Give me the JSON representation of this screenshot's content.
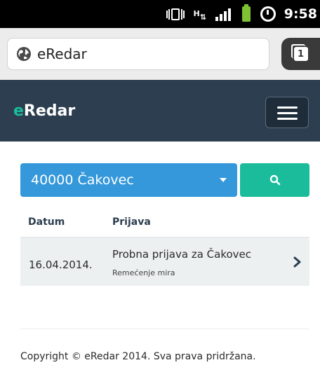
{
  "status_bar": {
    "time": "9:58",
    "network_type": "H",
    "icons": [
      "vibrate-icon",
      "hspa-data-icon",
      "signal-icon",
      "battery-icon",
      "alarm-icon"
    ]
  },
  "browser": {
    "url": "eRedar",
    "tab_count": "1"
  },
  "navbar": {
    "brand_prefix": "e",
    "brand_rest": "Redar",
    "brand_colors": {
      "accent": "#1abc9c",
      "background": "#2c3e50"
    }
  },
  "search": {
    "city_selected": "40000 Čakovec",
    "select_color": "#3498db",
    "button_color": "#1abc9c"
  },
  "table": {
    "columns": [
      "Datum",
      "Prijava"
    ],
    "rows": [
      {
        "date": "16.04.2014.",
        "title": "Probna prijava za Čakovec",
        "category": "Remećenje mira"
      }
    ]
  },
  "footer": {
    "copyright": "Copyright © eRedar 2014. Sva prava pridržana."
  }
}
